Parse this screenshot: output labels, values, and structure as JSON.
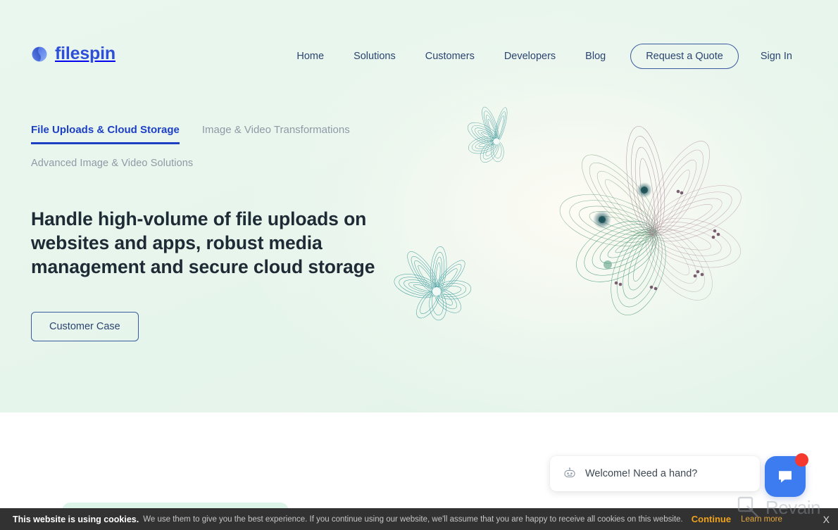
{
  "brand": {
    "name": "filespin",
    "logo_icon": "sphere-swirl-icon",
    "color": "#2f4fd8"
  },
  "nav": {
    "items": [
      {
        "label": "Home"
      },
      {
        "label": "Solutions"
      },
      {
        "label": "Customers"
      },
      {
        "label": "Developers"
      },
      {
        "label": "Blog"
      }
    ],
    "cta": {
      "label": "Request a Quote"
    },
    "signin": {
      "label": "Sign In"
    }
  },
  "hero": {
    "tabs": [
      {
        "label": "File Uploads & Cloud Storage",
        "active": true
      },
      {
        "label": "Image & Video Transformations",
        "active": false
      }
    ],
    "subtitle": "Advanced Image & Video Solutions",
    "headline": "Handle high-volume of file uploads on websites and apps, robust media management and secure cloud storage",
    "button": {
      "label": "Customer Case"
    },
    "background_color": "#e9f6ee"
  },
  "chat": {
    "bubble_text": "Welcome! Need a hand?",
    "bubble_icon": "robot-head-icon",
    "launcher_icon": "chat-bubble-icon",
    "launcher_color": "#3d7bf0",
    "badge_color": "#f5392f"
  },
  "cookie_bar": {
    "strong": "This website is using cookies.",
    "text": "We use them to give you the best experience. If you continue using our website, we'll assume that you are happy to receive all cookies on this website.",
    "continue_label": "Continue",
    "learn_more_label": "Learn more",
    "close_label": "X",
    "background_color": "#323232",
    "continue_color": "#f0a31e"
  },
  "watermark": {
    "text": "Revain",
    "icon": "revain-magnifier-icon"
  }
}
